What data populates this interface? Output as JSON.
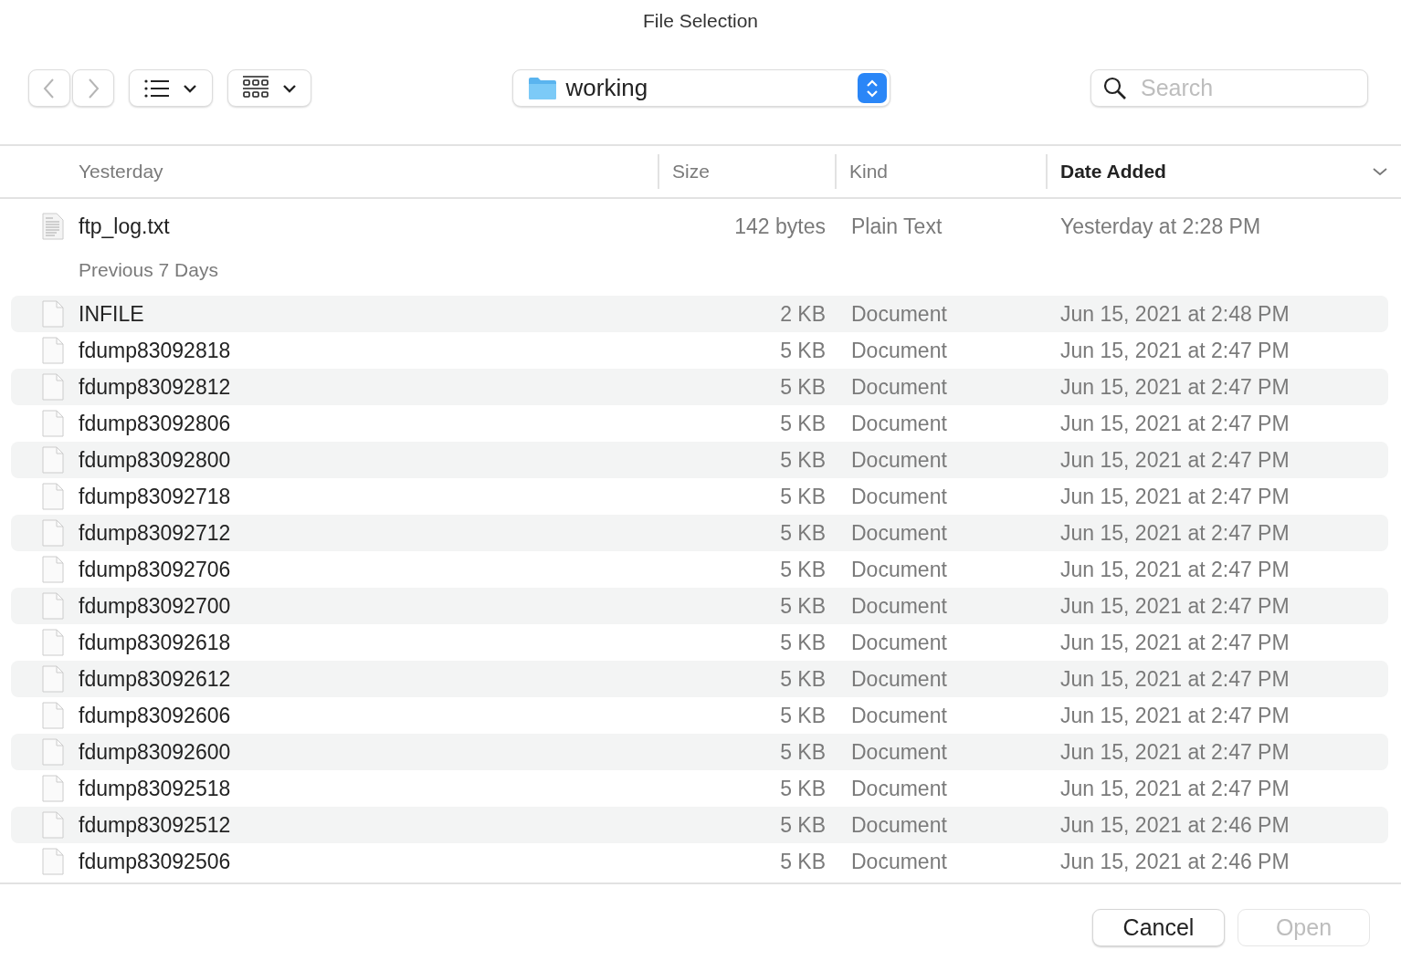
{
  "window": {
    "title": "File Selection"
  },
  "toolbar": {
    "location": "working",
    "search": {
      "placeholder": "Search"
    }
  },
  "columns": [
    {
      "label": "Yesterday",
      "sorted": false
    },
    {
      "label": "Size",
      "sorted": false
    },
    {
      "label": "Kind",
      "sorted": false
    },
    {
      "label": "Date Added",
      "sorted": true
    }
  ],
  "groups": [
    {
      "files": [
        {
          "name": "ftp_log.txt",
          "kind": "text",
          "size": "142 bytes",
          "kind_text": "Plain Text",
          "date": "Yesterday at 2:28 PM"
        }
      ]
    },
    {
      "label": "Previous 7 Days",
      "files": [
        {
          "name": "INFILE",
          "kind": "document",
          "size": "2 KB",
          "kind_text": "Document",
          "date": "Jun 15, 2021 at 2:48 PM"
        },
        {
          "name": "fdump83092818",
          "kind": "document",
          "size": "5 KB",
          "kind_text": "Document",
          "date": "Jun 15, 2021 at 2:47 PM"
        },
        {
          "name": "fdump83092812",
          "kind": "document",
          "size": "5 KB",
          "kind_text": "Document",
          "date": "Jun 15, 2021 at 2:47 PM"
        },
        {
          "name": "fdump83092806",
          "kind": "document",
          "size": "5 KB",
          "kind_text": "Document",
          "date": "Jun 15, 2021 at 2:47 PM"
        },
        {
          "name": "fdump83092800",
          "kind": "document",
          "size": "5 KB",
          "kind_text": "Document",
          "date": "Jun 15, 2021 at 2:47 PM"
        },
        {
          "name": "fdump83092718",
          "kind": "document",
          "size": "5 KB",
          "kind_text": "Document",
          "date": "Jun 15, 2021 at 2:47 PM"
        },
        {
          "name": "fdump83092712",
          "kind": "document",
          "size": "5 KB",
          "kind_text": "Document",
          "date": "Jun 15, 2021 at 2:47 PM"
        },
        {
          "name": "fdump83092706",
          "kind": "document",
          "size": "5 KB",
          "kind_text": "Document",
          "date": "Jun 15, 2021 at 2:47 PM"
        },
        {
          "name": "fdump83092700",
          "kind": "document",
          "size": "5 KB",
          "kind_text": "Document",
          "date": "Jun 15, 2021 at 2:47 PM"
        },
        {
          "name": "fdump83092618",
          "kind": "document",
          "size": "5 KB",
          "kind_text": "Document",
          "date": "Jun 15, 2021 at 2:47 PM"
        },
        {
          "name": "fdump83092612",
          "kind": "document",
          "size": "5 KB",
          "kind_text": "Document",
          "date": "Jun 15, 2021 at 2:47 PM"
        },
        {
          "name": "fdump83092606",
          "kind": "document",
          "size": "5 KB",
          "kind_text": "Document",
          "date": "Jun 15, 2021 at 2:47 PM"
        },
        {
          "name": "fdump83092600",
          "kind": "document",
          "size": "5 KB",
          "kind_text": "Document",
          "date": "Jun 15, 2021 at 2:47 PM"
        },
        {
          "name": "fdump83092518",
          "kind": "document",
          "size": "5 KB",
          "kind_text": "Document",
          "date": "Jun 15, 2021 at 2:47 PM"
        },
        {
          "name": "fdump83092512",
          "kind": "document",
          "size": "5 KB",
          "kind_text": "Document",
          "date": "Jun 15, 2021 at 2:46 PM"
        },
        {
          "name": "fdump83092506",
          "kind": "document",
          "size": "5 KB",
          "kind_text": "Document",
          "date": "Jun 15, 2021 at 2:46 PM"
        }
      ]
    }
  ],
  "buttons": [
    {
      "label": "Cancel",
      "disabled": false
    },
    {
      "label": "Open",
      "disabled": true
    }
  ]
}
